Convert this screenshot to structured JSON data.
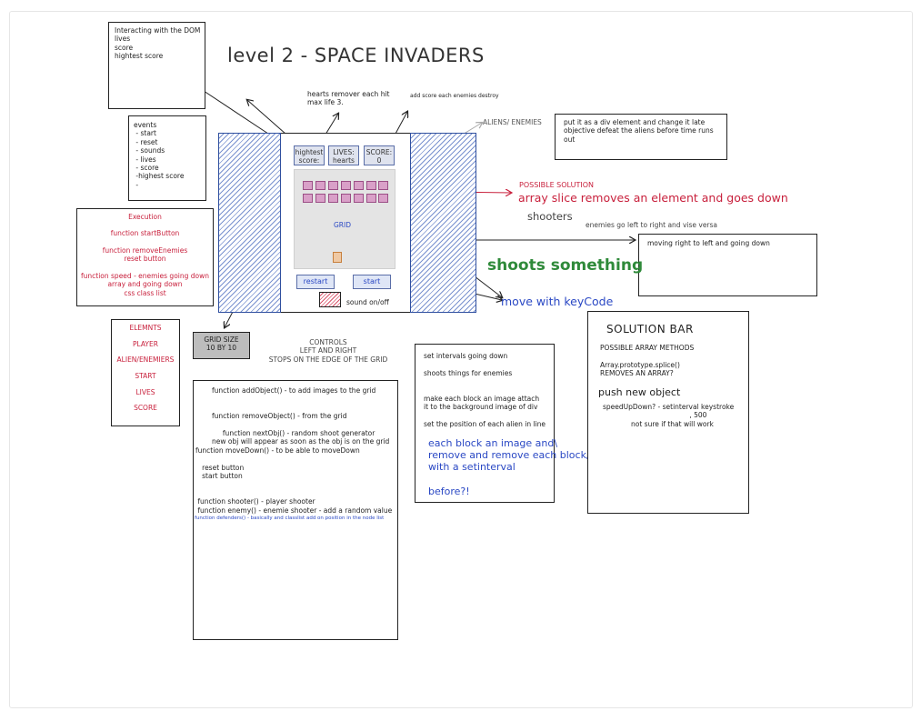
{
  "title": "level 2 - SPACE INVADERS",
  "notes": {
    "dom_box": "Interacting with the DOM\nlives\nscore\nhightest score",
    "events_box": "events\n - start\n - reset\n - sounds\n - lives\n - score\n -highest score\n -",
    "execution_title": "Execution",
    "execution_items": "function startButton\n\nfunction removeEnemies\nreset button\n\nfunction speed - enemies going down\narray and going down\ncss class list",
    "elements_box": "ELEMNTS\n\nPLAYER\n\nALIEN/ENEMIERS\n\nSTART\n\nLIVES\n\nSCORE",
    "grid_size": "GRID SIZE\n10 BY 10",
    "controls": "CONTROLS\nLEFT AND RIGHT\nSTOPS ON THE EDGE OF THE GRID",
    "hearts_note": "hearts remover each hit\nmax life 3.",
    "score_note": "add score each enemies destroy",
    "aliens_label": "ALIENS/ ENEMIES",
    "div_note": "put it as a div element and change it late\nobjective defeat the aliens before time runs\nout",
    "possible_solution": "POSSIBLE SOLUTION",
    "array_slice": "array slice removes an element and goes down",
    "shooters": "shooters",
    "enemies_lr": "enemies go left to right and vise versa",
    "moving_box": "moving right to left and going down",
    "shoots_something": "shoots something",
    "keycode": "move with keyCode",
    "sound": "sound on/off",
    "functions_box_1": "function addObject() - to add images to the grid\n\n\nfunction removeObject() - from the grid\n\n     function nextObj() - random shoot generator\nnew obj will appear as soon as the obj is on the grid",
    "functions_box_2": "function moveDown() - to be able to moveDown\n\n   reset button\n   start button\n\n\n function shooter() - player shooter\n function enemy() - enemie shooter - add a random value",
    "defenders": "function defenders() - basically and classlist add on position in the node list",
    "intervals_box": "set intervals going down\n\nshoots things for enemies\n\n\nmake each block an image attach\nit to the background image of div\n\nset the position of each alien in line",
    "intervals_blue": "each block an image and\\\nremove and remove each block/image\nwith a setinterval\n\nbefore?!",
    "solution_title": "SOLUTION BAR",
    "solution_body": "POSSIBLE ARRAY METHODS\n\nArray.prototype.splice()\nREMOVES AN ARRAY?",
    "push_new": "push new object",
    "speed_note": "speedUpDown? - setinterval keystroke\n                                        , 500\n             not sure if that will work"
  },
  "game": {
    "highest_label": "hightest\nscore:",
    "lives_label": "LIVES:\nhearts",
    "score_label": "SCORE:\n0",
    "grid_label": "GRID",
    "restart": "restart",
    "start": "start"
  },
  "colors": {
    "red": "#c8203c",
    "blue": "#2a48c4",
    "green": "#2f8a3a",
    "hatch": "#7a92cf"
  }
}
